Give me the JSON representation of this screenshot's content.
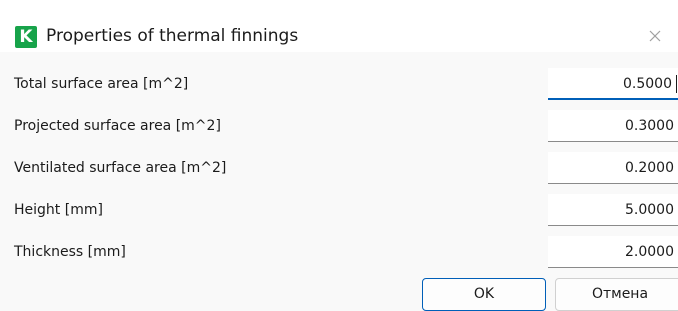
{
  "window": {
    "icon_letter": "K",
    "title": "Properties of thermal finnings"
  },
  "fields": [
    {
      "label": "Total surface area [m^2]",
      "value": "0.5000"
    },
    {
      "label": "Projected surface area [m^2]",
      "value": "0.3000"
    },
    {
      "label": "Ventilated surface area [m^2]",
      "value": "0.2000"
    },
    {
      "label": "Height [mm]",
      "value": "5.0000"
    },
    {
      "label": "Thickness [mm]",
      "value": "2.0000"
    }
  ],
  "buttons": {
    "ok_label": "OK",
    "cancel_label": "Отмена"
  },
  "colors": {
    "app_icon": "#17a34a",
    "accent": "#005fb8"
  },
  "icons": {
    "app": "app-k-logo-icon",
    "close": "close-icon"
  }
}
